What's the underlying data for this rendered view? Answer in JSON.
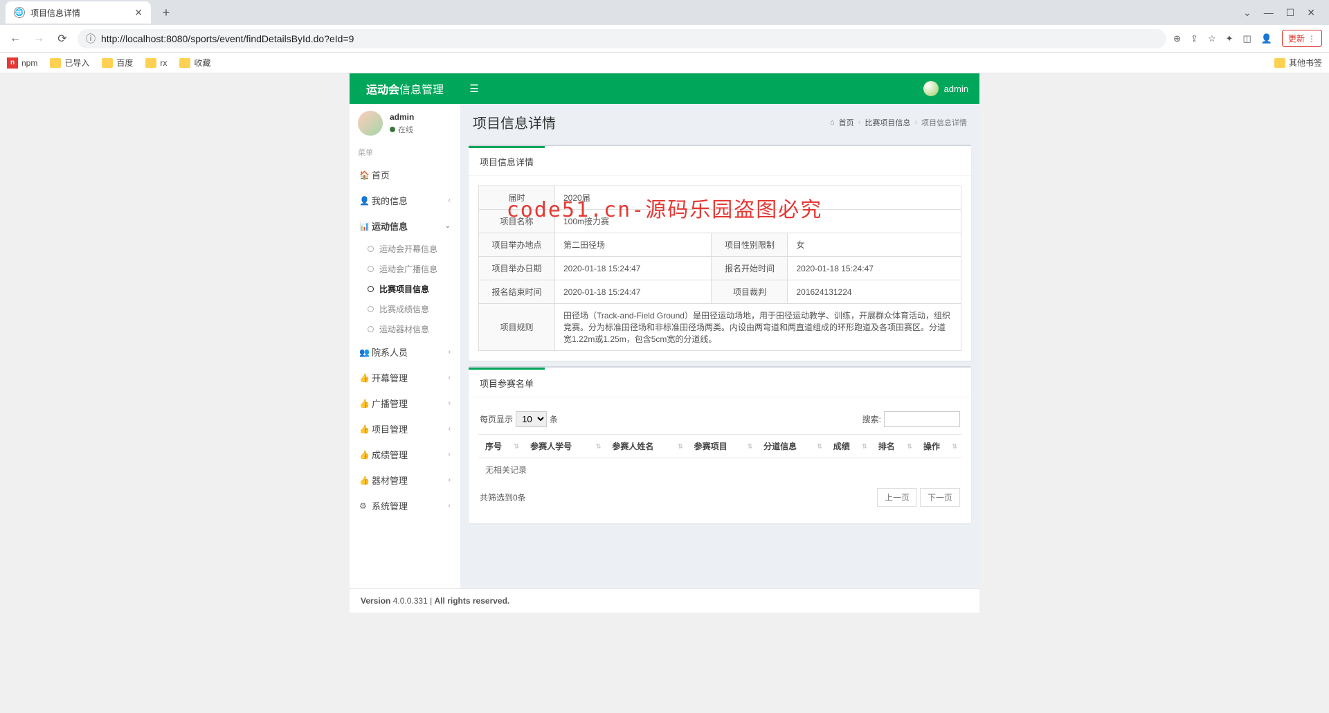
{
  "browser": {
    "tab_title": "项目信息详情",
    "url": "http://localhost:8080/sports/event/findDetailsById.do?eId=9",
    "url_host": "localhost",
    "update_label": "更新",
    "bookmarks": [
      "npm",
      "已导入",
      "百度",
      "rx",
      "收藏"
    ],
    "other_bookmarks": "其他书签"
  },
  "header": {
    "logo_bold": "运动会",
    "logo_rest": "信息管理",
    "user": "admin"
  },
  "sidebar": {
    "user": "admin",
    "status": "在线",
    "menu_header": "菜单",
    "items": [
      {
        "icon": "🏠",
        "label": "首页"
      },
      {
        "icon": "👤",
        "label": "我的信息",
        "arrow": "‹"
      },
      {
        "icon": "📊",
        "label": "运动信息",
        "arrow": "⌄",
        "expanded": true,
        "sub": [
          {
            "label": "运动会开幕信息"
          },
          {
            "label": "运动会广播信息"
          },
          {
            "label": "比赛项目信息",
            "active": true
          },
          {
            "label": "比赛成绩信息"
          },
          {
            "label": "运动器材信息"
          }
        ]
      },
      {
        "icon": "👥",
        "label": "院系人员",
        "arrow": "‹"
      },
      {
        "icon": "👍",
        "label": "开幕管理",
        "arrow": "‹"
      },
      {
        "icon": "👍",
        "label": "广播管理",
        "arrow": "‹"
      },
      {
        "icon": "👍",
        "label": "项目管理",
        "arrow": "‹"
      },
      {
        "icon": "👍",
        "label": "成绩管理",
        "arrow": "‹"
      },
      {
        "icon": "👍",
        "label": "器材管理",
        "arrow": "‹"
      },
      {
        "icon": "⚙",
        "label": "系统管理",
        "arrow": "‹"
      }
    ]
  },
  "page": {
    "title": "项目信息详情",
    "breadcrumb": [
      "首页",
      "比赛项目信息",
      "项目信息详情"
    ],
    "tab1": "项目信息详情",
    "tab2": "项目参赛名单",
    "details": {
      "session_label": "届时",
      "session": "2020届",
      "name_label": "项目名称",
      "name": "100m接力赛",
      "venue_label": "项目举办地点",
      "venue": "第二田径场",
      "gender_label": "项目性别限制",
      "gender": "女",
      "date_label": "项目举办日期",
      "date": "2020-01-18 15:24:47",
      "reg_start_label": "报名开始时间",
      "reg_start": "2020-01-18 15:24:47",
      "reg_end_label": "报名结束时间",
      "reg_end": "2020-01-18 15:24:47",
      "referee_label": "项目裁判",
      "referee": "201624131224",
      "rules_label": "项目规则",
      "rules": "田径场（Track-and-Field Ground）是田径运动场地，用于田径运动教学、训练，开展群众体育活动，组织竞赛。分为标准田径场和非标准田径场两类。内设由两弯道和两直道组成的环形跑道及各项田赛区。分道宽1.22m或1.25m，包含5cm宽的分道线。"
    },
    "datatable": {
      "length_prefix": "每页显示",
      "length_suffix": "条",
      "length_value": "10",
      "search_label": "搜索:",
      "columns": [
        "序号",
        "参赛人学号",
        "参赛人姓名",
        "参赛项目",
        "分道信息",
        "成绩",
        "排名",
        "操作"
      ],
      "empty": "无相关记录",
      "info": "共筛选到0条",
      "prev": "上一页",
      "next": "下一页"
    }
  },
  "footer": {
    "version_label": "Version",
    "version": "4.0.0.331",
    "rights": "All rights reserved."
  },
  "watermark": "code51.cn-源码乐园盗图必究"
}
